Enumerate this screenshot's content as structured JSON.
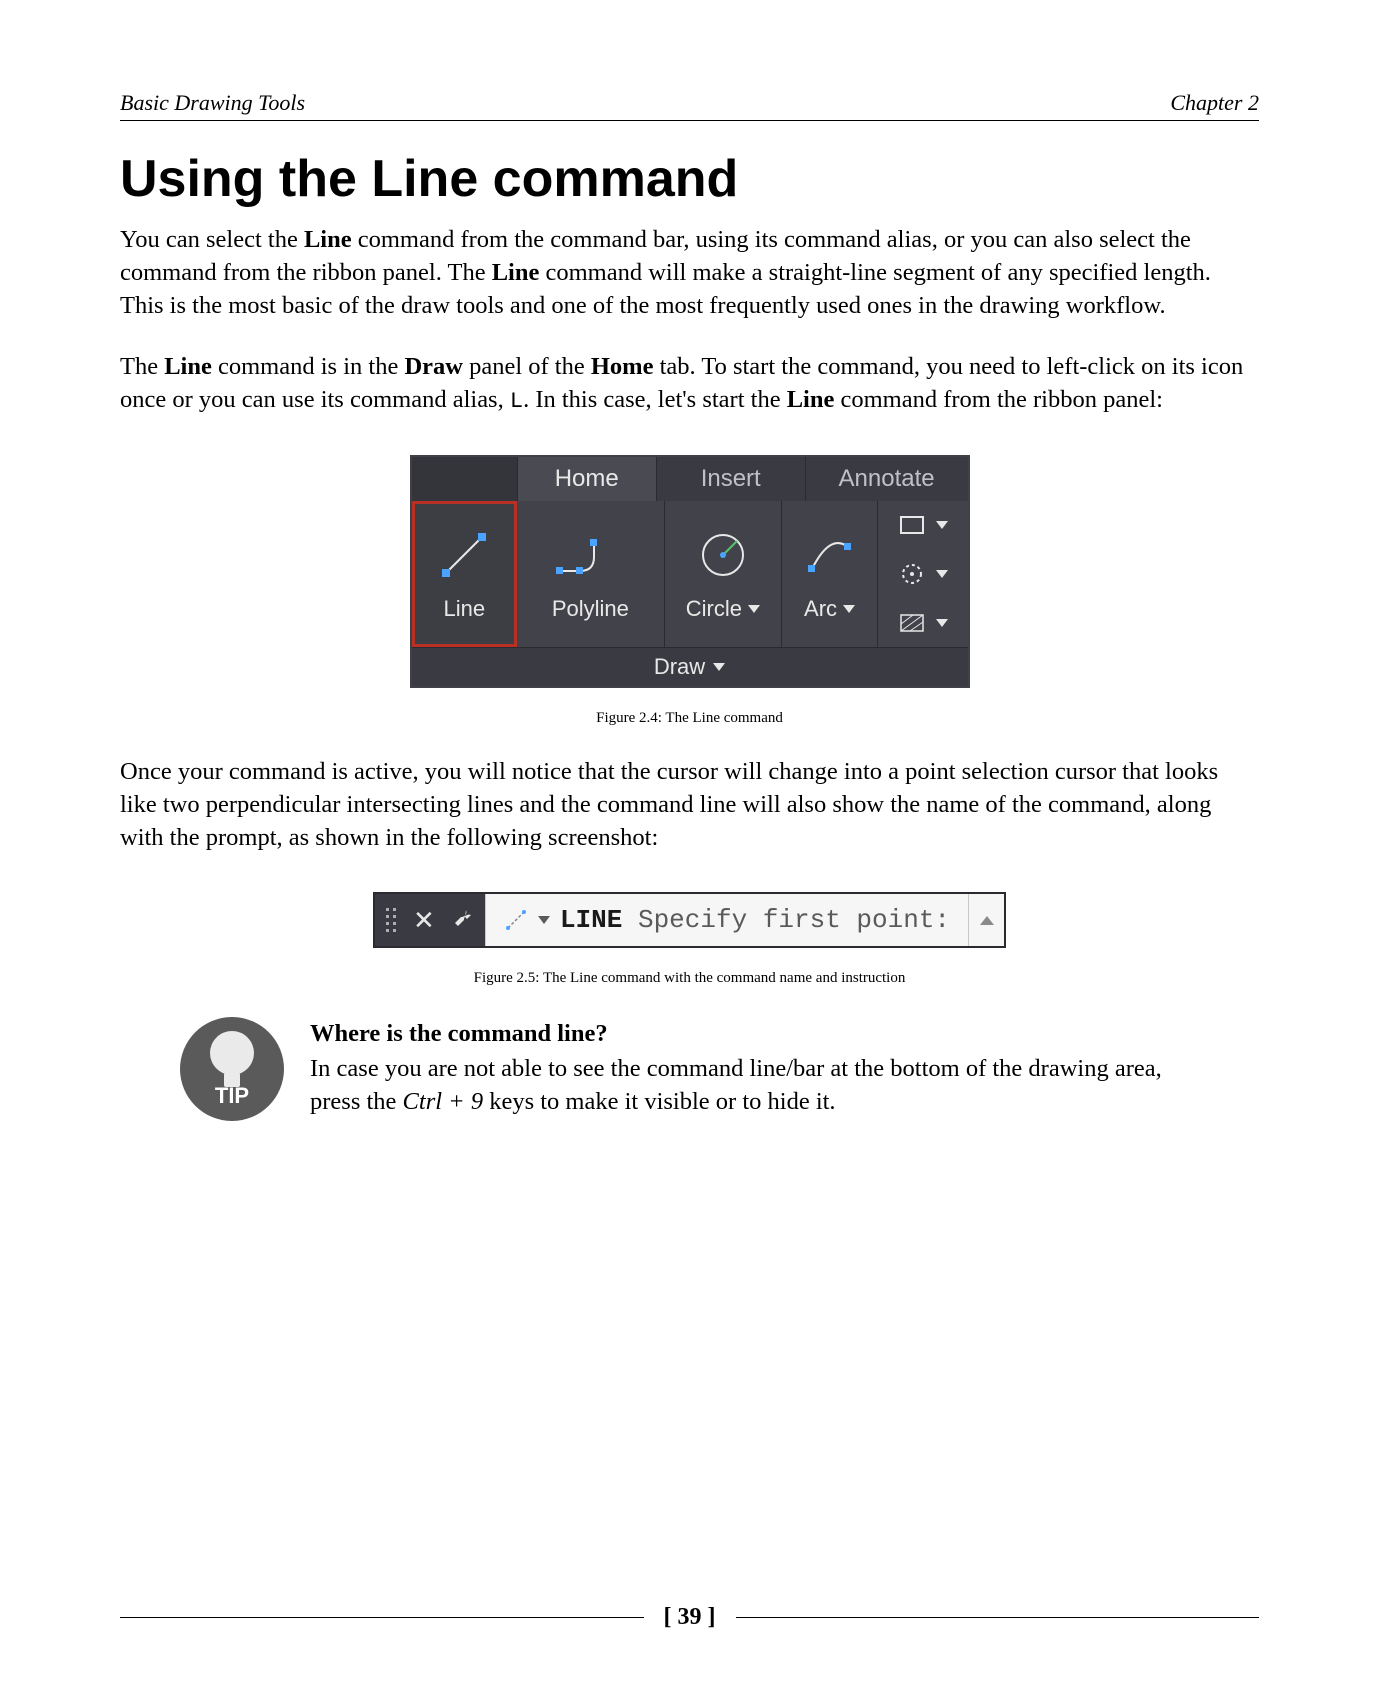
{
  "header": {
    "left": "Basic Drawing Tools",
    "right": "Chapter 2"
  },
  "heading": "Using the Line command",
  "para1": {
    "pre": "You can select the ",
    "b1": "Line",
    "mid1": " command from the command bar, using its command alias, or you can also select the command from the ribbon panel. The ",
    "b2": "Line",
    "post": " command will make a straight-line segment of any specified length. This is the most basic of the draw tools and one of the most frequently used ones in the drawing workflow."
  },
  "para2": {
    "s1": "The ",
    "b1": "Line",
    "s2": " command is in the ",
    "b2": "Draw",
    "s3": " panel of the ",
    "b3": "Home",
    "s4": " tab. To start the command, you need to left-click on its icon once or you can use its command alias, ",
    "code": "L",
    "s5": ". In this case, let's start the ",
    "b4": "Line",
    "s6": " command from the ribbon panel:"
  },
  "ribbon": {
    "tabs": {
      "home": "Home",
      "insert": "Insert",
      "annotate": "Annotate"
    },
    "tools": {
      "line": "Line",
      "polyline": "Polyline",
      "circle": "Circle",
      "arc": "Arc"
    },
    "panel_label": "Draw"
  },
  "fig1_caption": "Figure 2.4: The Line command",
  "para3": "Once your command is active, you will notice that the cursor will change into a point selection cursor that looks like two perpendicular intersecting lines and the command line will also show the name of the command, along with the prompt, as shown in the following screenshot:",
  "cmdbar": {
    "name": "LINE",
    "prompt": " Specify first point:"
  },
  "fig2_caption": "Figure 2.5: The Line command with the command name and instruction",
  "tip": {
    "label": "TIP",
    "question": "Where is the command line?",
    "t1": "In case you are not able to see the command line/bar at the bottom of the drawing area, press the ",
    "keys": "Ctrl + 9",
    "t2": " keys to make it visible or to hide it."
  },
  "page_number": "[ 39 ]"
}
